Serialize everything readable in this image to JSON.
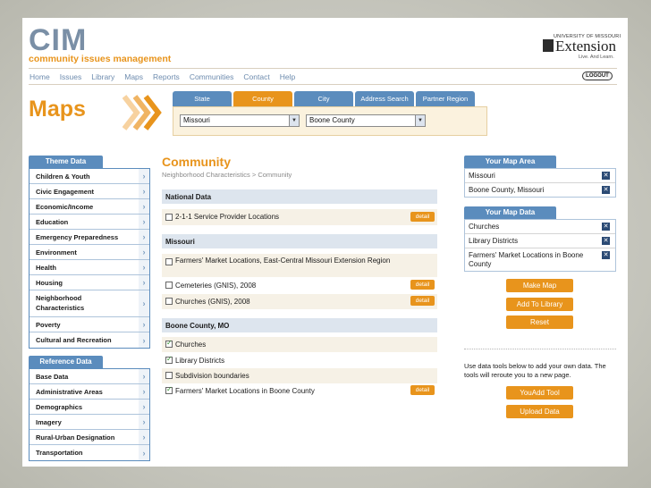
{
  "header": {
    "logo": "CIM",
    "logo_subtitle": "community issues management",
    "partner_university": "UNIVERSITY OF MISSOURI",
    "partner_name": "Extension",
    "partner_tagline": "Live. And Learn.",
    "logout_label": "LOGOUT"
  },
  "nav": [
    "Home",
    "Issues",
    "Library",
    "Maps",
    "Reports",
    "Communities",
    "Contact",
    "Help"
  ],
  "page_title": "Maps",
  "tabs": [
    {
      "label": "State",
      "active": false
    },
    {
      "label": "County",
      "active": true
    },
    {
      "label": "City",
      "active": false
    },
    {
      "label": "Address Search",
      "active": false
    },
    {
      "label": "Partner Region",
      "active": false
    }
  ],
  "selects": {
    "state_value": "Missouri",
    "county_value": "Boone County"
  },
  "theme_data": {
    "heading": "Theme Data",
    "items": [
      "Children & Youth",
      "Civic Engagement",
      "Economic/Income",
      "Education",
      "Emergency Preparedness",
      "Environment",
      "Health",
      "Housing",
      "Neighborhood Characteristics",
      "Poverty",
      "Cultural and Recreation"
    ]
  },
  "reference_data": {
    "heading": "Reference Data",
    "items": [
      "Base Data",
      "Administrative Areas",
      "Demographics",
      "Imagery",
      "Rural-Urban Designation",
      "Transportation"
    ]
  },
  "community": {
    "title": "Community",
    "breadcrumb": "Neighborhood Characteristics > Community",
    "sections": [
      {
        "heading": "National Data",
        "rows": [
          {
            "label": "2-1-1 Service Provider Locations",
            "checked": false,
            "detail": "detail"
          }
        ]
      },
      {
        "heading": "Missouri",
        "rows": [
          {
            "label": "Farmers' Market Locations, East-Central Missouri Extension Region",
            "checked": false,
            "detail": ""
          },
          {
            "label": "Cemeteries (GNIS), 2008",
            "checked": false,
            "detail": "detail"
          },
          {
            "label": "Churches (GNIS), 2008",
            "checked": false,
            "detail": "detail"
          }
        ]
      },
      {
        "heading": "Boone County, MO",
        "rows": [
          {
            "label": "Churches",
            "checked": true,
            "detail": ""
          },
          {
            "label": "Library Districts",
            "checked": true,
            "detail": ""
          },
          {
            "label": "Subdivision boundaries",
            "checked": false,
            "detail": ""
          },
          {
            "label": "Farmers' Market Locations in Boone County",
            "checked": true,
            "detail": "detail"
          }
        ]
      }
    ]
  },
  "map_area": {
    "heading": "Your Map Area",
    "items": [
      "Missouri",
      "Boone County, Missouri"
    ]
  },
  "map_data": {
    "heading": "Your Map Data",
    "items": [
      "Churches",
      "Library Districts",
      "Farmers' Market Locations in Boone County"
    ]
  },
  "actions": {
    "make_map": "Make Map",
    "add_to_library": "Add To Library",
    "reset": "Reset",
    "tools_note": "Use data tools below to add your own data. The tools will reroute you to a new page.",
    "youadd_tool": "YouAdd Tool",
    "upload_data": "Upload Data"
  },
  "colors": {
    "accent_orange": "#e8941c",
    "nav_blue": "#5b8cbd",
    "logo_grey": "#7a8fa6",
    "remove_navy": "#2b4a74"
  },
  "icons": {
    "chevron": "chevron-right-icon",
    "remove": "remove-x-icon",
    "dropdown": "chevron-down-icon"
  }
}
